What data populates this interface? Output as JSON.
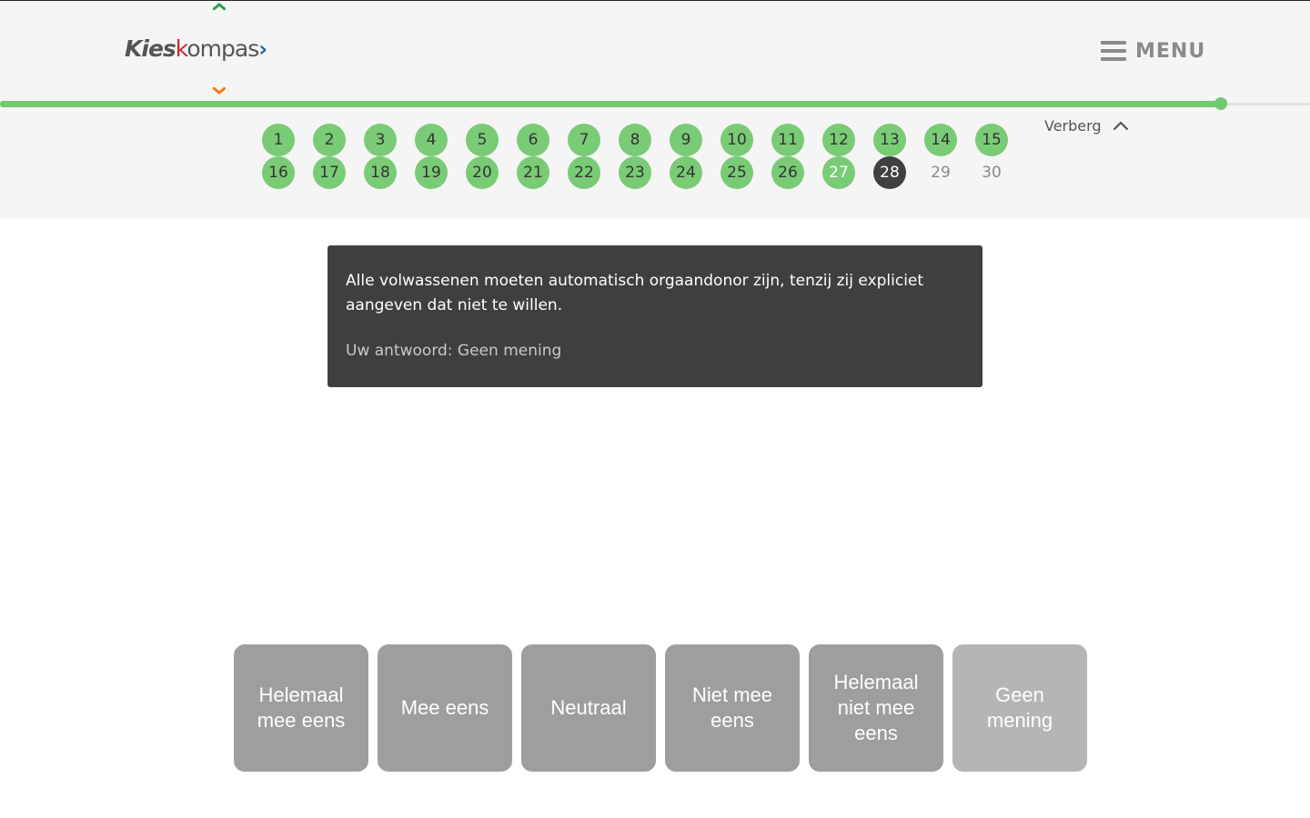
{
  "brand": {
    "logo_part1": "Kies",
    "logo_part2": "k",
    "logo_part3": "ompas",
    "logo_arrow": "›"
  },
  "menu": {
    "label": "MENU"
  },
  "progress": {
    "fraction": 0.932
  },
  "statements": {
    "row1": [
      {
        "n": "1",
        "state": "done"
      },
      {
        "n": "2",
        "state": "done"
      },
      {
        "n": "3",
        "state": "done"
      },
      {
        "n": "4",
        "state": "done"
      },
      {
        "n": "5",
        "state": "done"
      },
      {
        "n": "6",
        "state": "done"
      },
      {
        "n": "7",
        "state": "done"
      },
      {
        "n": "8",
        "state": "done"
      },
      {
        "n": "9",
        "state": "done"
      },
      {
        "n": "10",
        "state": "done"
      },
      {
        "n": "11",
        "state": "done"
      },
      {
        "n": "12",
        "state": "done"
      },
      {
        "n": "13",
        "state": "done"
      },
      {
        "n": "14",
        "state": "done"
      },
      {
        "n": "15",
        "state": "done"
      }
    ],
    "row2": [
      {
        "n": "16",
        "state": "done"
      },
      {
        "n": "17",
        "state": "done"
      },
      {
        "n": "18",
        "state": "done"
      },
      {
        "n": "19",
        "state": "done"
      },
      {
        "n": "20",
        "state": "done"
      },
      {
        "n": "21",
        "state": "done"
      },
      {
        "n": "22",
        "state": "done"
      },
      {
        "n": "23",
        "state": "done"
      },
      {
        "n": "24",
        "state": "done"
      },
      {
        "n": "25",
        "state": "done"
      },
      {
        "n": "26",
        "state": "done"
      },
      {
        "n": "27",
        "state": "done-light"
      },
      {
        "n": "28",
        "state": "current"
      },
      {
        "n": "29",
        "state": "todo"
      },
      {
        "n": "30",
        "state": "todo"
      }
    ]
  },
  "hide_toggle": {
    "label": "Verberg"
  },
  "question": {
    "text": "Alle volwassenen moeten automatisch orgaandonor zijn, tenzij zij expliciet aangeven dat niet te willen.",
    "answer_line": "Uw antwoord: Geen mening"
  },
  "answers": [
    {
      "label": "Helemaal mee eens",
      "selected": false
    },
    {
      "label": "Mee eens",
      "selected": false
    },
    {
      "label": "Neutraal",
      "selected": false
    },
    {
      "label": "Niet mee eens",
      "selected": false
    },
    {
      "label": "Helemaal niet mee eens",
      "selected": false
    },
    {
      "label": "Geen mening",
      "selected": true
    }
  ],
  "colors": {
    "green": "#72c96e",
    "dark": "#3f3f3f",
    "button_grey": "#9d9e9f",
    "logo_red": "#d6242a",
    "logo_blue": "#1f6aa5",
    "chev_orange": "#f07c1b",
    "chev_green": "#2aa24a"
  }
}
